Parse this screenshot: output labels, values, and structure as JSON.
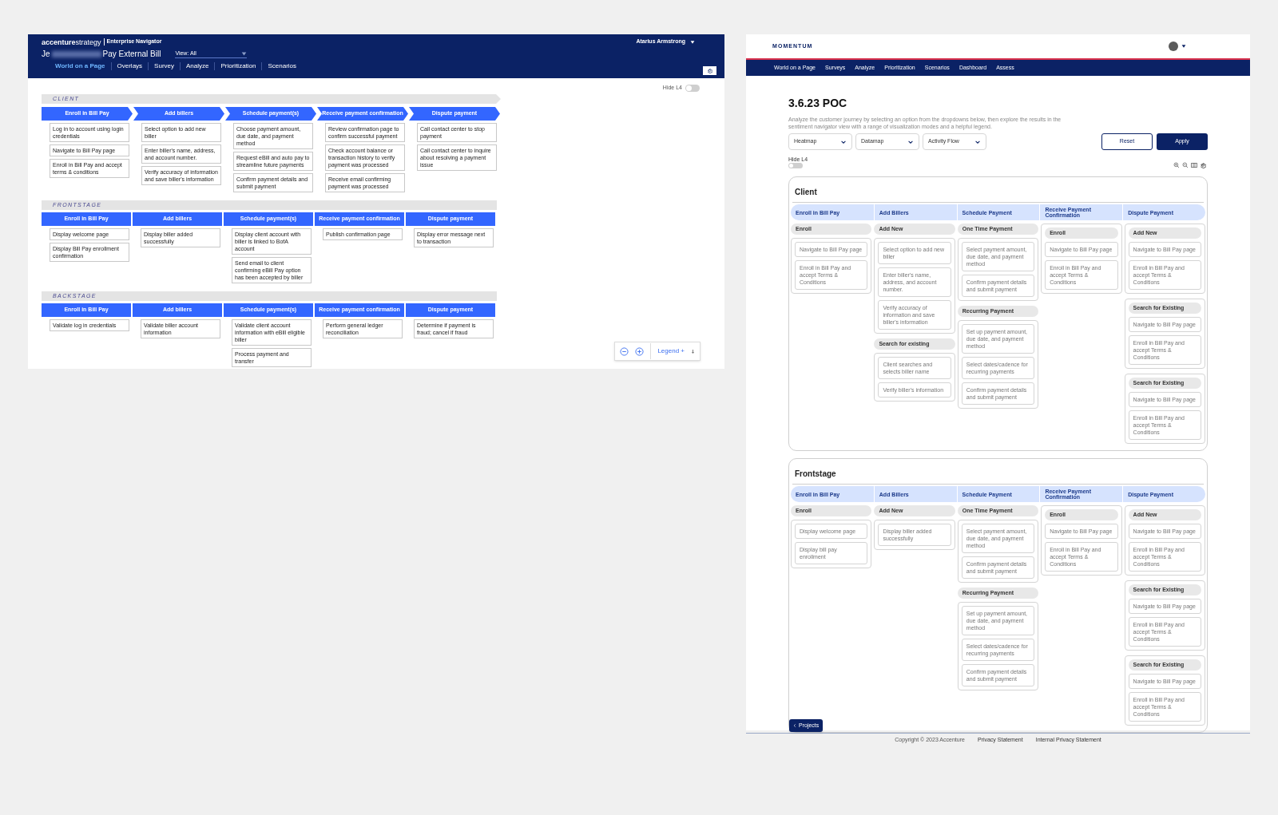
{
  "left_app": {
    "logo": "**accenture**strategy",
    "product": "Enterprise Navigator",
    "user": "Atarius Armstrong",
    "title_start": "Je",
    "title": "Pay External Bill",
    "view": "View: All",
    "tabs": [
      {
        "label": "World on a Page",
        "selected": true
      },
      {
        "label": "Overlays",
        "selected": false
      },
      {
        "label": "Survey",
        "selected": false
      },
      {
        "label": "Analyze",
        "selected": false
      },
      {
        "label": "Prioritization",
        "selected": false
      },
      {
        "label": "Scenarios",
        "selected": false
      }
    ],
    "hide_l4": {
      "label": "Hide L4",
      "on": false
    },
    "lanes": [
      {
        "label": "CLIENT",
        "kind": "chevron",
        "stages": [
          {
            "label": "Enroll in Bill Pay",
            "cards": [
              "Log in to account using login credentials",
              "Navigate to Bill Pay page",
              "Enroll in Bill Pay and accept terms & conditions"
            ]
          },
          {
            "label": "Add billers",
            "cards": [
              "Select option to add new biller",
              "Enter biller's name, address, and account number.",
              "Verify accuracy of information and save biller's information"
            ]
          },
          {
            "label": "Schedule payment(s)",
            "cards": [
              "Choose payment amount, due date, and payment method",
              "Request eBill and auto pay to streamline future payments",
              "Confirm payment details and submit payment"
            ]
          },
          {
            "label": "Receive payment confirmation",
            "cards": [
              "Review confirmation page to confirm successful payment",
              "Check account balance or transaction history to verify payment was processed",
              "Receive email confirming payment was processed"
            ]
          },
          {
            "label": "Dispute payment",
            "cards": [
              "Call contact center to stop payment",
              "Call contact center to inquire about resolving a payment issue"
            ]
          }
        ]
      },
      {
        "label": "FRONTSTAGE",
        "kind": "block",
        "stages": [
          {
            "label": "Enroll in Bill Pay",
            "cards": [
              "Display welcome page",
              "Display Bill Pay enrollment confirmation"
            ]
          },
          {
            "label": "Add billers",
            "cards": [
              "Display biller added successfully"
            ]
          },
          {
            "label": "Schedule payment(s)",
            "cards": [
              "Display client account with biller is linked to BofA account",
              "Send email to client confirming eBill Pay option has been accepted by biller"
            ]
          },
          {
            "label": "Receive payment confirmation",
            "cards": [
              "Publish confirmation page"
            ]
          },
          {
            "label": "Dispute payment",
            "cards": [
              "Display error message next to transaction"
            ]
          }
        ]
      },
      {
        "label": "BACKSTAGE",
        "kind": "block",
        "stages": [
          {
            "label": "Enroll in Bill Pay",
            "cards": [
              "Validate log in credentials"
            ]
          },
          {
            "label": "Add billers",
            "cards": [
              "Validate biller account information"
            ]
          },
          {
            "label": "Schedule payment(s)",
            "cards": [
              "Validate client account information with eBill eligible biller",
              "Process payment and transfer"
            ]
          },
          {
            "label": "Receive payment confirmation",
            "cards": [
              "Perform general ledger reconciliation"
            ]
          },
          {
            "label": "Dispute payment",
            "cards": [
              "Determine if payment is fraud; cancel if fraud"
            ]
          }
        ]
      }
    ],
    "legend": "Legend +"
  },
  "momentum": {
    "brand": "MOMENTUM",
    "nav": [
      "World on a Page",
      "Surveys",
      "Analyze",
      "Prioritization",
      "Scenarios",
      "Dashboard",
      "Assess"
    ],
    "title": "3.6.23 POC",
    "description": "Analyze the customer journey by selecting an option from the dropdowns below, then explore the results in the sentiment navigator view with a range of visualization modes and a helpful legend.",
    "dropdowns": [
      "Heatmap",
      "Datamap",
      "Activity Flow"
    ],
    "buttons": [
      {
        "label": "Reset",
        "kind": "outline"
      },
      {
        "label": "Apply",
        "kind": "solid"
      }
    ],
    "hide_l4": {
      "label": "Hide L4",
      "on": false
    },
    "lanes": [
      {
        "title": "Client",
        "stages": [
          {
            "label": "Enroll in Bill Pay",
            "groups": [
              {
                "kind": "detached",
                "label": "Enroll",
                "steps": [
                  "Navigate to Bill Pay page",
                  "Enroll in Bill Pay and accept Terms & Conditions"
                ]
              }
            ]
          },
          {
            "label": "Add Billers",
            "groups": [
              {
                "kind": "detached",
                "label": "Add New",
                "steps": [
                  "Select option to add new biller",
                  "Enter biller's name, address, and account number.",
                  "Verify accuracy of information and save biller's information"
                ]
              },
              {
                "kind": "detached",
                "label": "Search for existing",
                "steps": [
                  "Client searches and selects biller name",
                  "Verify biller's information"
                ]
              }
            ]
          },
          {
            "label": "Schedule Payment",
            "groups": [
              {
                "kind": "detached",
                "label": "One Time Payment",
                "steps": [
                  "Select payment amount, due date, and payment method",
                  "Confirm payment details and submit payment"
                ]
              },
              {
                "kind": "detached",
                "label": "Recurring Payment",
                "steps": [
                  "Set up payment amount, due date, and payment method",
                  "Select dates/cadence for recurring payments",
                  "Confirm payment details and submit payment"
                ]
              }
            ]
          },
          {
            "label": "Receive Payment Confirmation",
            "groups": [
              {
                "kind": "boxed",
                "label": "Enroll",
                "steps": [
                  "Navigate to Bill Pay page",
                  "Enroll in Bill Pay and accept Terms & Conditions"
                ]
              }
            ]
          },
          {
            "label": "Dispute Payment",
            "groups": [
              {
                "kind": "boxed",
                "label": "Add New",
                "steps": [
                  "Navigate to Bill Pay page",
                  "Enroll in Bill Pay and accept Terms & Conditions"
                ]
              },
              {
                "kind": "boxed",
                "label": "Search for Existing",
                "steps": [
                  "Navigate to Bill Pay page",
                  "Enroll in Bill Pay and accept Terms & Conditions"
                ]
              },
              {
                "kind": "boxed",
                "label": "Search for Existing",
                "steps": [
                  "Navigate to Bill Pay page",
                  "Enroll in Bill Pay and accept Terms & Conditions"
                ]
              }
            ]
          }
        ]
      },
      {
        "title": "Frontstage",
        "stages": [
          {
            "label": "Enroll in Bill Pay",
            "groups": [
              {
                "kind": "detached",
                "label": "Enroll",
                "steps": [
                  "Display welcome page",
                  "Display bill pay enrollment"
                ]
              }
            ]
          },
          {
            "label": "Add Billers",
            "groups": [
              {
                "kind": "detached",
                "label": "Add New",
                "steps": [
                  "Display biller added successfully"
                ]
              }
            ]
          },
          {
            "label": "Schedule Payment",
            "groups": [
              {
                "kind": "detached",
                "label": "One Time Payment",
                "steps": [
                  "Select payment amount, due date, and payment method",
                  "Confirm payment details and submit payment"
                ]
              },
              {
                "kind": "detached",
                "label": "Recurring Payment",
                "steps": [
                  "Set up payment amount, due date, and payment method",
                  "Select dates/cadence for recurring payments",
                  "Confirm payment details and submit payment"
                ]
              }
            ]
          },
          {
            "label": "Receive Payment Confirmation",
            "groups": [
              {
                "kind": "boxed",
                "label": "Enroll",
                "steps": [
                  "Navigate to Bill Pay page",
                  "Enroll in Bill Pay and accept Terms & Conditions"
                ]
              }
            ]
          },
          {
            "label": "Dispute Payment",
            "groups": [
              {
                "kind": "boxed",
                "label": "Add New",
                "steps": [
                  "Navigate to Bill Pay page",
                  "Enroll in Bill Pay and accept Terms & Conditions"
                ]
              },
              {
                "kind": "boxed",
                "label": "Search for Existing",
                "steps": [
                  "Navigate to Bill Pay page",
                  "Enroll in Bill Pay and accept Terms & Conditions"
                ]
              },
              {
                "kind": "boxed",
                "label": "Search for Existing",
                "steps": [
                  "Navigate to Bill Pay page",
                  "Enroll in Bill Pay and accept Terms & Conditions"
                ]
              }
            ]
          }
        ]
      }
    ],
    "projects_button": "Projects",
    "footer": [
      {
        "text": "Copyright © 2023 Accenture",
        "kind": "text"
      },
      {
        "text": "Privacy Statement",
        "kind": "link"
      },
      {
        "text": "Internal Privacy Statement",
        "kind": "link"
      }
    ]
  }
}
